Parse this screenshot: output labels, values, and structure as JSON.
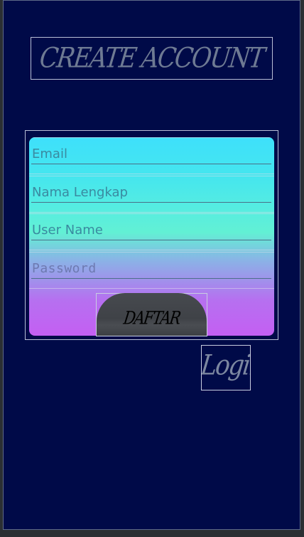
{
  "header": {
    "title": "CREATE ACCOUNT"
  },
  "form": {
    "fields": [
      {
        "name": "email",
        "placeholder": "Email",
        "value": ""
      },
      {
        "name": "full_name",
        "placeholder": "Nama Lengkap",
        "value": ""
      },
      {
        "name": "username",
        "placeholder": "User Name",
        "value": ""
      },
      {
        "name": "password",
        "placeholder": "Password",
        "value": ""
      }
    ],
    "submit_label": "DAFTAR"
  },
  "login_link": {
    "label": "Login"
  },
  "colors": {
    "background": "#000a48",
    "gradient_top": "#3ee0fb",
    "gradient_mid": "#62f0d4",
    "gradient_bottom": "#c45ff3",
    "button": "#414449"
  }
}
